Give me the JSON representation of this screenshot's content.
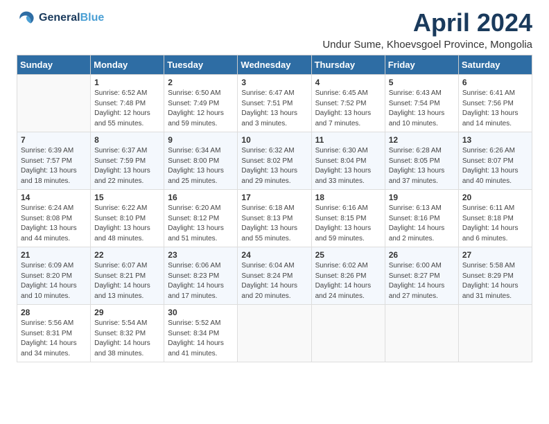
{
  "header": {
    "logo_line1": "General",
    "logo_line2": "Blue",
    "month_title": "April 2024",
    "location": "Undur Sume, Khoevsgoel Province, Mongolia"
  },
  "calendar": {
    "days_of_week": [
      "Sunday",
      "Monday",
      "Tuesday",
      "Wednesday",
      "Thursday",
      "Friday",
      "Saturday"
    ],
    "weeks": [
      [
        {
          "day": "",
          "info": ""
        },
        {
          "day": "1",
          "info": "Sunrise: 6:52 AM\nSunset: 7:48 PM\nDaylight: 12 hours\nand 55 minutes."
        },
        {
          "day": "2",
          "info": "Sunrise: 6:50 AM\nSunset: 7:49 PM\nDaylight: 12 hours\nand 59 minutes."
        },
        {
          "day": "3",
          "info": "Sunrise: 6:47 AM\nSunset: 7:51 PM\nDaylight: 13 hours\nand 3 minutes."
        },
        {
          "day": "4",
          "info": "Sunrise: 6:45 AM\nSunset: 7:52 PM\nDaylight: 13 hours\nand 7 minutes."
        },
        {
          "day": "5",
          "info": "Sunrise: 6:43 AM\nSunset: 7:54 PM\nDaylight: 13 hours\nand 10 minutes."
        },
        {
          "day": "6",
          "info": "Sunrise: 6:41 AM\nSunset: 7:56 PM\nDaylight: 13 hours\nand 14 minutes."
        }
      ],
      [
        {
          "day": "7",
          "info": "Sunrise: 6:39 AM\nSunset: 7:57 PM\nDaylight: 13 hours\nand 18 minutes."
        },
        {
          "day": "8",
          "info": "Sunrise: 6:37 AM\nSunset: 7:59 PM\nDaylight: 13 hours\nand 22 minutes."
        },
        {
          "day": "9",
          "info": "Sunrise: 6:34 AM\nSunset: 8:00 PM\nDaylight: 13 hours\nand 25 minutes."
        },
        {
          "day": "10",
          "info": "Sunrise: 6:32 AM\nSunset: 8:02 PM\nDaylight: 13 hours\nand 29 minutes."
        },
        {
          "day": "11",
          "info": "Sunrise: 6:30 AM\nSunset: 8:04 PM\nDaylight: 13 hours\nand 33 minutes."
        },
        {
          "day": "12",
          "info": "Sunrise: 6:28 AM\nSunset: 8:05 PM\nDaylight: 13 hours\nand 37 minutes."
        },
        {
          "day": "13",
          "info": "Sunrise: 6:26 AM\nSunset: 8:07 PM\nDaylight: 13 hours\nand 40 minutes."
        }
      ],
      [
        {
          "day": "14",
          "info": "Sunrise: 6:24 AM\nSunset: 8:08 PM\nDaylight: 13 hours\nand 44 minutes."
        },
        {
          "day": "15",
          "info": "Sunrise: 6:22 AM\nSunset: 8:10 PM\nDaylight: 13 hours\nand 48 minutes."
        },
        {
          "day": "16",
          "info": "Sunrise: 6:20 AM\nSunset: 8:12 PM\nDaylight: 13 hours\nand 51 minutes."
        },
        {
          "day": "17",
          "info": "Sunrise: 6:18 AM\nSunset: 8:13 PM\nDaylight: 13 hours\nand 55 minutes."
        },
        {
          "day": "18",
          "info": "Sunrise: 6:16 AM\nSunset: 8:15 PM\nDaylight: 13 hours\nand 59 minutes."
        },
        {
          "day": "19",
          "info": "Sunrise: 6:13 AM\nSunset: 8:16 PM\nDaylight: 14 hours\nand 2 minutes."
        },
        {
          "day": "20",
          "info": "Sunrise: 6:11 AM\nSunset: 8:18 PM\nDaylight: 14 hours\nand 6 minutes."
        }
      ],
      [
        {
          "day": "21",
          "info": "Sunrise: 6:09 AM\nSunset: 8:20 PM\nDaylight: 14 hours\nand 10 minutes."
        },
        {
          "day": "22",
          "info": "Sunrise: 6:07 AM\nSunset: 8:21 PM\nDaylight: 14 hours\nand 13 minutes."
        },
        {
          "day": "23",
          "info": "Sunrise: 6:06 AM\nSunset: 8:23 PM\nDaylight: 14 hours\nand 17 minutes."
        },
        {
          "day": "24",
          "info": "Sunrise: 6:04 AM\nSunset: 8:24 PM\nDaylight: 14 hours\nand 20 minutes."
        },
        {
          "day": "25",
          "info": "Sunrise: 6:02 AM\nSunset: 8:26 PM\nDaylight: 14 hours\nand 24 minutes."
        },
        {
          "day": "26",
          "info": "Sunrise: 6:00 AM\nSunset: 8:27 PM\nDaylight: 14 hours\nand 27 minutes."
        },
        {
          "day": "27",
          "info": "Sunrise: 5:58 AM\nSunset: 8:29 PM\nDaylight: 14 hours\nand 31 minutes."
        }
      ],
      [
        {
          "day": "28",
          "info": "Sunrise: 5:56 AM\nSunset: 8:31 PM\nDaylight: 14 hours\nand 34 minutes."
        },
        {
          "day": "29",
          "info": "Sunrise: 5:54 AM\nSunset: 8:32 PM\nDaylight: 14 hours\nand 38 minutes."
        },
        {
          "day": "30",
          "info": "Sunrise: 5:52 AM\nSunset: 8:34 PM\nDaylight: 14 hours\nand 41 minutes."
        },
        {
          "day": "",
          "info": ""
        },
        {
          "day": "",
          "info": ""
        },
        {
          "day": "",
          "info": ""
        },
        {
          "day": "",
          "info": ""
        }
      ]
    ]
  }
}
